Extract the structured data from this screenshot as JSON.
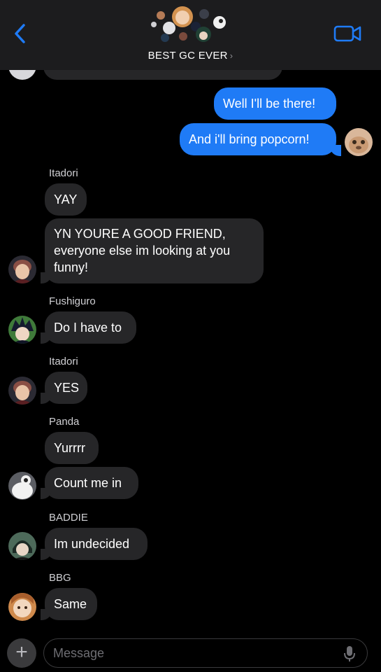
{
  "header": {
    "group_name": "BEST GC EVER",
    "chevron": "›",
    "back_icon": "chevron-left-icon",
    "video_icon": "video-camera-icon"
  },
  "messages": [
    {
      "text": "Well I'll be there!"
    },
    {
      "text": "And i'll bring popcorn!"
    },
    {
      "sender": "Itadori",
      "text": "YAY"
    },
    {
      "text": "YN YOURE A GOOD FRIEND, everyone else im looking at you funny!"
    },
    {
      "sender": "Fushiguro",
      "text": "Do I have to"
    },
    {
      "sender": "Itadori",
      "text": "YES"
    },
    {
      "sender": "Panda",
      "text": "Yurrrr"
    },
    {
      "text": "Count me in"
    },
    {
      "sender": "BADDIE",
      "text": "Im undecided"
    },
    {
      "sender": "BBG",
      "text": "Same"
    }
  ],
  "composer": {
    "placeholder": "Message",
    "plus": "+",
    "mic_icon": "microphone-icon"
  },
  "colors": {
    "outgoing": "#1f7bf6",
    "incoming": "#262628",
    "accent": "#1f7bf6",
    "header_bg": "#1c1c1e"
  }
}
